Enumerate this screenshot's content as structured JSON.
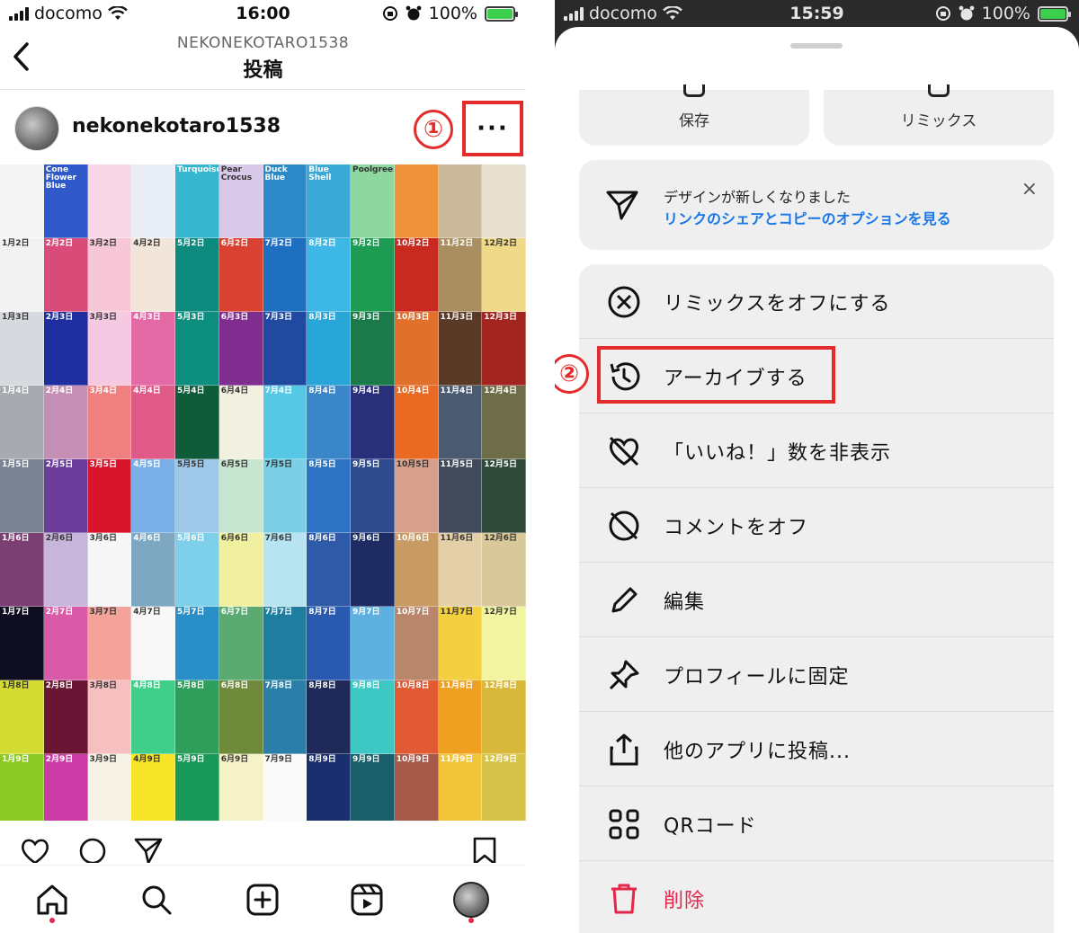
{
  "left": {
    "status": {
      "carrier": "docomo",
      "time": "16:00",
      "battery": "100%"
    },
    "nav": {
      "back_icon": "chevron-left-icon",
      "subtitle": "NEKONEKOTARO1538",
      "title": "投稿"
    },
    "post": {
      "username": "nekonekotaro1538",
      "step_label": "①",
      "more_label": "···"
    },
    "grid_colors": [
      [
        "#f4f4f4",
        "#2f58c9",
        "#f7d6e6",
        "#e9eef6",
        "#37b6d0",
        "#d8c9e9",
        "#2a89c6",
        "#3aa9d8",
        "#8ed8a0",
        "#f0923a",
        "#c9b899",
        "#e8e0cf"
      ],
      [
        "#f2f2f2",
        "#d94b78",
        "#f7c7d7",
        "#f2e6da",
        "#0d8a7e",
        "#d94133",
        "#1f6fc0",
        "#3db7e6",
        "#1e9c54",
        "#c92a1f",
        "#a98f5f",
        "#f1d98a"
      ],
      [
        "#d6d9de",
        "#1f2e9f",
        "#f6c9e3",
        "#e46aa6",
        "#0e8e7e",
        "#7f2e8f",
        "#1f4aa0",
        "#28a6d8",
        "#1c7a4a",
        "#e0702b",
        "#5a3a26",
        "#a2261f"
      ],
      [
        "#a7aab0",
        "#c58fb5",
        "#f08080",
        "#e05a88",
        "#0f5c3a",
        "#f2f0e1",
        "#56c8e6",
        "#3a86c8",
        "#2a2f7a",
        "#ea6a23",
        "#4a5a70",
        "#6d6d4a"
      ],
      [
        "#7b8392",
        "#6a3b98",
        "#d9152e",
        "#79aee6",
        "#9ec7e8",
        "#c6e6d0",
        "#7ccfe6",
        "#2d73c4",
        "#2c4a8c",
        "#d7a08c",
        "#404a5a",
        "#2f4a3a"
      ],
      [
        "#7b3f73",
        "#c7b5dc",
        "#f7f7f7",
        "#7ea7c2",
        "#7ed0ea",
        "#f0f0a0",
        "#b7e4f0",
        "#2e5aa8",
        "#1f2c64",
        "#c89a64",
        "#e3cfa8",
        "#d8c89a"
      ],
      [
        "#0e0e20",
        "#d85aa8",
        "#f3a39a",
        "#f8f8f8",
        "#2a8fc6",
        "#5aaa72",
        "#1f7ea0",
        "#2a5ab0",
        "#5db0df",
        "#b8866a",
        "#f4d040",
        "#f1f5a0"
      ],
      [
        "#d4dc34",
        "#6a1534",
        "#f7c0c0",
        "#3fcf8a",
        "#2e9e5a",
        "#6e8a3a",
        "#2a7ea8",
        "#1f2a58",
        "#3dc8c4",
        "#e15a34",
        "#f0a020",
        "#d8b83a"
      ],
      [
        "#8ac823",
        "#cc3aa8",
        "#f6f2e6",
        "#f5e428",
        "#1a9a5a",
        "#f6f2c8",
        "#fafafa",
        "#1a2f6e",
        "#1a5e6a",
        "#a85a4a",
        "#f2c43a",
        "#d6c34a"
      ]
    ],
    "grid_labels": [
      [
        "",
        "Cone Flower\nBlue",
        "",
        "",
        "Turquoise",
        "Pear Crocus",
        "Duck Blue",
        "Blue Shell",
        "Poolgreen",
        "",
        "",
        ""
      ],
      [
        "1月2日",
        "2月2日",
        "3月2日",
        "4月2日",
        "5月2日",
        "6月2日",
        "7月2日",
        "8月2日",
        "9月2日",
        "10月2日",
        "11月2日",
        "12月2日"
      ],
      [
        "1月3日",
        "2月3日",
        "3月3日",
        "4月3日",
        "5月3日",
        "6月3日",
        "7月3日",
        "8月3日",
        "9月3日",
        "10月3日",
        "11月3日",
        "12月3日"
      ],
      [
        "1月4日",
        "2月4日",
        "3月4日",
        "4月4日",
        "5月4日",
        "6月4日",
        "7月4日",
        "8月4日",
        "9月4日",
        "10月4日",
        "11月4日",
        "12月4日"
      ],
      [
        "1月5日",
        "2月5日",
        "3月5日",
        "4月5日",
        "5月5日",
        "6月5日",
        "7月5日",
        "8月5日",
        "9月5日",
        "10月5日",
        "11月5日",
        "12月5日"
      ],
      [
        "1月6日",
        "2月6日",
        "3月6日",
        "4月6日",
        "5月6日",
        "6月6日",
        "7月6日",
        "8月6日",
        "9月6日",
        "10月6日",
        "11月6日",
        "12月6日"
      ],
      [
        "1月7日",
        "2月7日",
        "3月7日",
        "4月7日",
        "5月7日",
        "6月7日",
        "7月7日",
        "8月7日",
        "9月7日",
        "10月7日",
        "11月7日",
        "12月7日"
      ],
      [
        "1月8日",
        "2月8日",
        "3月8日",
        "4月8日",
        "5月8日",
        "6月8日",
        "7月8日",
        "8月8日",
        "9月8日",
        "10月8日",
        "11月8日",
        "12月8日"
      ],
      [
        "1月9日",
        "2月9日",
        "3月9日",
        "4月9日",
        "5月9日",
        "6月9日",
        "7月9日",
        "8月9日",
        "9月9日",
        "10月9日",
        "11月9日",
        "12月9日"
      ]
    ],
    "actions": [
      "heart-icon",
      "comment-icon",
      "share-icon",
      "bookmark-icon"
    ],
    "tabbar": [
      "home-icon",
      "search-icon",
      "create-icon",
      "reels-icon",
      "profile-avatar"
    ]
  },
  "right": {
    "status": {
      "carrier": "docomo",
      "time": "15:59",
      "battery": "100%"
    },
    "top_cards": {
      "save": "保存",
      "remix": "リミックス"
    },
    "notice": {
      "line1": "デザインが新しくなりました",
      "line2": "リンクのシェアとコピーのオプションを見る",
      "close": "×"
    },
    "step_label": "②",
    "menu": [
      {
        "label": "リミックスをオフにする",
        "icon": "x-circle-icon"
      },
      {
        "label": "アーカイブする",
        "icon": "archive-history-icon"
      },
      {
        "label": "「いいね！」数を非表示",
        "icon": "heart-off-icon"
      },
      {
        "label": "コメントをオフ",
        "icon": "comment-off-icon"
      },
      {
        "label": "編集",
        "icon": "pencil-icon"
      },
      {
        "label": "プロフィールに固定",
        "icon": "pin-icon"
      },
      {
        "label": "他のアプリに投稿...",
        "icon": "share-upload-icon"
      },
      {
        "label": "QRコード",
        "icon": "qr-code-icon"
      },
      {
        "label": "削除",
        "icon": "trash-icon"
      }
    ],
    "colors": {
      "danger": "#e3264a",
      "link": "#1a77e8",
      "highlight": "#e32b2b"
    }
  }
}
